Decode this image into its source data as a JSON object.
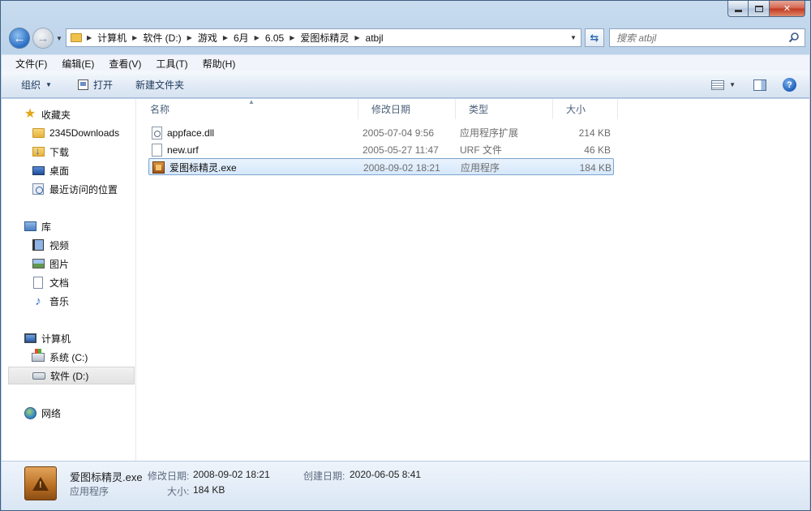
{
  "window": {
    "title_buttons": [
      "minimize",
      "maximize",
      "close"
    ]
  },
  "address": {
    "crumbs": [
      "计算机",
      "软件 (D:)",
      "游戏",
      "6月",
      "6.05",
      "爱图标精灵",
      "atbjl"
    ]
  },
  "search": {
    "placeholder": "搜索 atbjl"
  },
  "menu": {
    "items": [
      "文件(F)",
      "编辑(E)",
      "查看(V)",
      "工具(T)",
      "帮助(H)"
    ]
  },
  "toolbar": {
    "organize": "组织",
    "open": "打开",
    "new_folder": "新建文件夹",
    "help": "?"
  },
  "sidebar": {
    "favorites": "收藏夹",
    "fav_items": [
      "2345Downloads",
      "下载",
      "桌面",
      "最近访问的位置"
    ],
    "libraries": "库",
    "lib_items": [
      "视频",
      "图片",
      "文档",
      "音乐"
    ],
    "computer": "计算机",
    "drives": [
      "系统 (C:)",
      "软件 (D:)"
    ],
    "network": "网络"
  },
  "columns": {
    "name": "名称",
    "date": "修改日期",
    "type": "类型",
    "size": "大小"
  },
  "files": [
    {
      "name": "appface.dll",
      "date": "2005-07-04 9:56",
      "type": "应用程序扩展",
      "size": "214 KB",
      "icon": "dll-icon"
    },
    {
      "name": "new.urf",
      "date": "2005-05-27 11:47",
      "type": "URF 文件",
      "size": "46 KB",
      "icon": "file-icon"
    },
    {
      "name": "爱图标精灵.exe",
      "date": "2008-09-02 18:21",
      "type": "应用程序",
      "size": "184 KB",
      "icon": "exe-icon"
    }
  ],
  "details": {
    "name": "爱图标精灵.exe",
    "type": "应用程序",
    "modified_label": "修改日期:",
    "modified": "2008-09-02 18:21",
    "created_label": "创建日期:",
    "created": "2020-06-05 8:41",
    "size_label": "大小:",
    "size": "184 KB"
  },
  "colors": {
    "accent": "#2a6ec4",
    "selection": "#d5e8fb",
    "selection_border": "#7da2ce"
  }
}
